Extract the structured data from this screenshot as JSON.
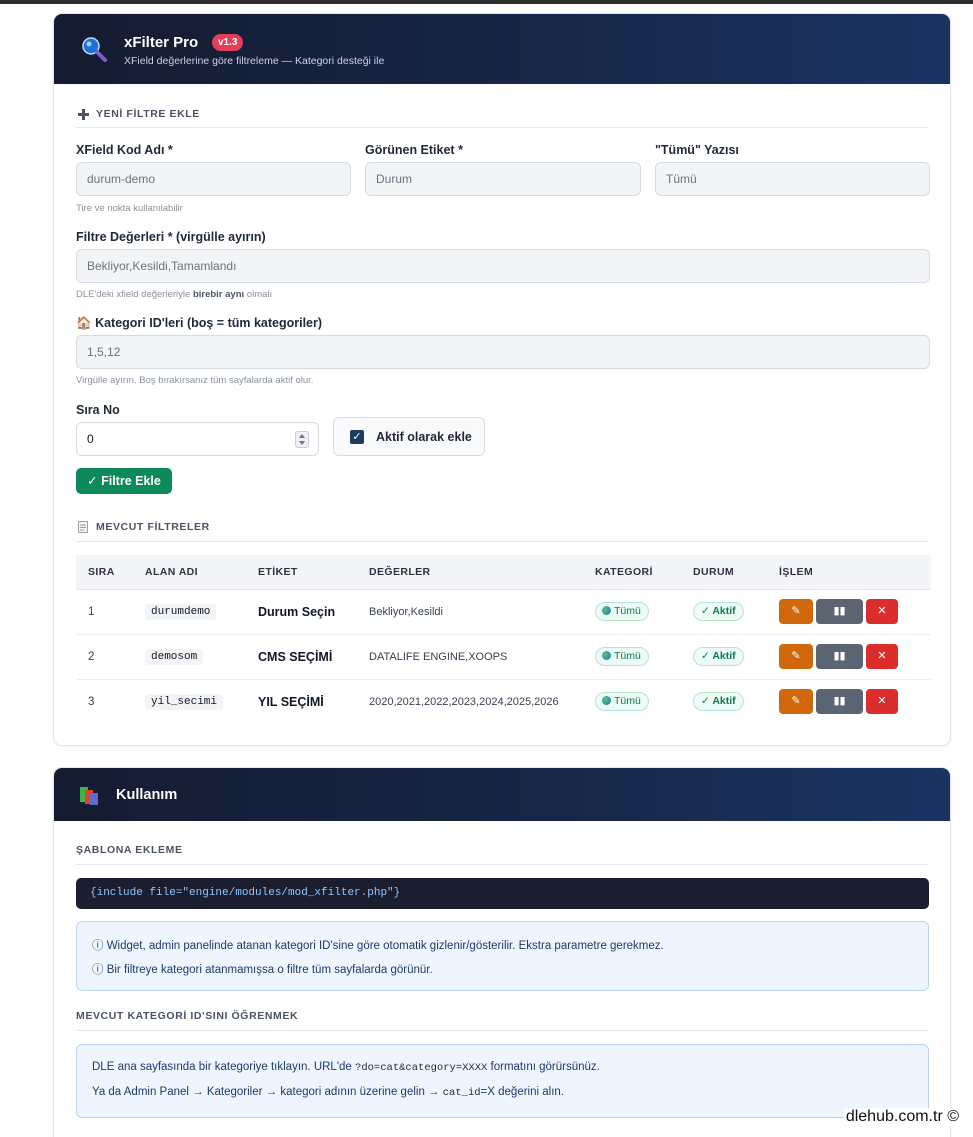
{
  "header": {
    "title": "xFilter Pro",
    "version": "v1.3",
    "subtitle": "XField değerlerine göre filtreleme — Kategori desteği ile"
  },
  "add_section": {
    "title": "YENİ FİLTRE EKLE",
    "xfield_label": "XField Kod Adı *",
    "xfield_placeholder": "durum-demo",
    "xfield_hint": "Tire ve nokta kullanılabilir",
    "label_label": "Görünen Etiket *",
    "label_placeholder": "Durum",
    "all_label": "\"Tümü\" Yazısı",
    "all_placeholder": "Tümü",
    "values_label": "Filtre Değerleri * (virgülle ayırın)",
    "values_placeholder": "Bekliyor,Kesildi,Tamamlandı",
    "values_hint_pre": "DLE'deki xfield değerleriyle ",
    "values_hint_bold": "birebir aynı",
    "values_hint_post": " olmalı",
    "cat_icon": "🏠",
    "cat_label": "Kategori ID'leri (boş = tüm kategoriler)",
    "cat_placeholder": "1,5,12",
    "cat_hint": "Virgülle ayırın. Boş bırakırsanız tüm sayfalarda aktif olur.",
    "order_label": "Sıra No",
    "order_value": "0",
    "active_label": "Aktif olarak ekle",
    "submit_label": "✓ Filtre Ekle"
  },
  "list_section": {
    "title": "MEVCUT FİLTRELER",
    "columns": [
      "SIRA",
      "ALAN ADI",
      "ETİKET",
      "DEĞERLER",
      "KATEGORİ",
      "DURUM",
      "İŞLEM"
    ],
    "rows": [
      {
        "order": "1",
        "field": "durumdemo",
        "label": "Durum Seçin",
        "values": "Bekliyor,Kesildi",
        "category": "Tümü",
        "status": "✓ Aktif"
      },
      {
        "order": "2",
        "field": "demosom",
        "label": "CMS SEÇİMİ",
        "values": "DATALIFE ENGINE,XOOPS",
        "category": "Tümü",
        "status": "✓ Aktif"
      },
      {
        "order": "3",
        "field": "yil_secimi",
        "label": "YIL SEÇİMİ",
        "values": "2020,2021,2022,2023,2024,2025,2026",
        "category": "Tümü",
        "status": "✓ Aktif"
      }
    ],
    "btn_edit": "✎",
    "btn_pause": "▮▮",
    "btn_delete": "✕"
  },
  "usage": {
    "title": "Kullanım",
    "template_title": "ŞABLONA EKLEME",
    "code": "{include file=\"engine/modules/mod_xfilter.php\"}",
    "info1": "ⓘ Widget, admin panelinde atanan kategori ID'sine göre otomatik gizlenir/gösterilir. Ekstra parametre gerekmez.",
    "info2": "ⓘ Bir filtreye kategori atanmamışsa o filtre tüm sayfalarda görünür.",
    "cat_id_title": "MEVCUT KATEGORİ ID'SINI ÖĞRENMEK",
    "cat_line1_pre": "DLE ana sayfasında bir kategoriye tıklayın. URL'de ",
    "cat_line1_code": "?do=cat&category=XXXX",
    "cat_line1_post": " formatını görürsünüz.",
    "cat_line2_pre": "Ya da Admin Panel → Kategoriler → kategori adının üzerine gelin → ",
    "cat_line2_code": "cat_id",
    "cat_line2_post": "=X değerini alın."
  },
  "footer": {
    "brand": "dlehub.com.tr ©"
  },
  "colors": {
    "accent": "#0e8a5a",
    "header_bg": "#151b30",
    "badge": "#e53e57"
  }
}
